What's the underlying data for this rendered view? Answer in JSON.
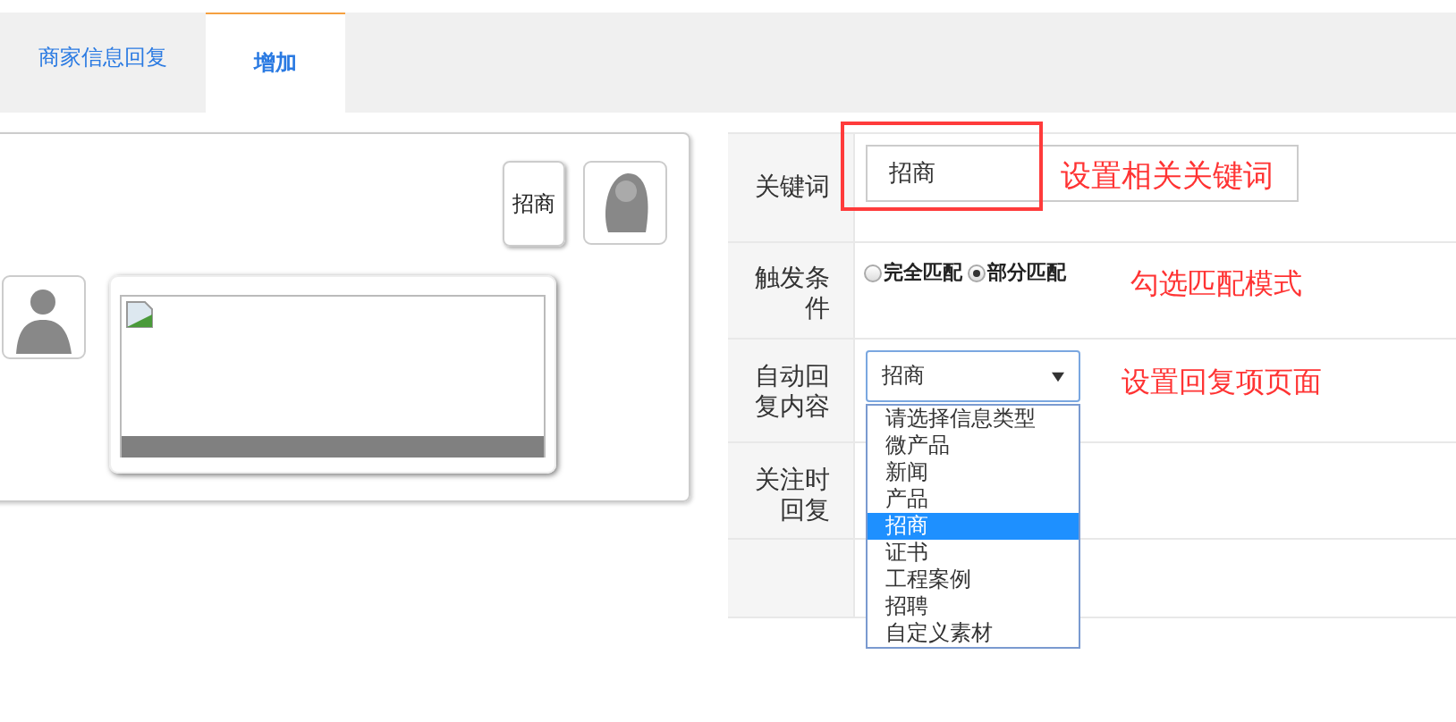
{
  "tabs": [
    {
      "label": "商家信息回复",
      "selected": false
    },
    {
      "label": "增加",
      "selected": true
    }
  ],
  "chat": [
    {
      "kind": "text",
      "outgoing": true,
      "text": "招商"
    },
    {
      "kind": "image",
      "outgoing": false
    }
  ],
  "form": {
    "keyword": {
      "label": "关键词",
      "value": "招商",
      "highlighted": true,
      "annotation": "设置相关关键词"
    },
    "trigger": {
      "label": "触发条件",
      "options": [
        {
          "label": "完全匹配",
          "selected": false
        },
        {
          "label": "部分匹配",
          "selected": true
        }
      ],
      "annotation": "勾选匹配模式"
    },
    "reply": {
      "label": "自动回复内容",
      "value": "招商",
      "expanded": true,
      "annotation": "设置回复项页面",
      "options": [
        {
          "label": "请选择信息类型",
          "selected": false
        },
        {
          "label": "微产品",
          "selected": false
        },
        {
          "label": "新闻",
          "selected": false
        },
        {
          "label": "产品",
          "selected": false
        },
        {
          "label": "招商",
          "selected": true
        },
        {
          "label": "证书",
          "selected": false
        },
        {
          "label": "工程案例",
          "selected": false
        },
        {
          "label": "招聘",
          "selected": false
        },
        {
          "label": "自定义素材",
          "selected": false
        }
      ]
    },
    "follow": {
      "label": "关注时回复"
    }
  }
}
